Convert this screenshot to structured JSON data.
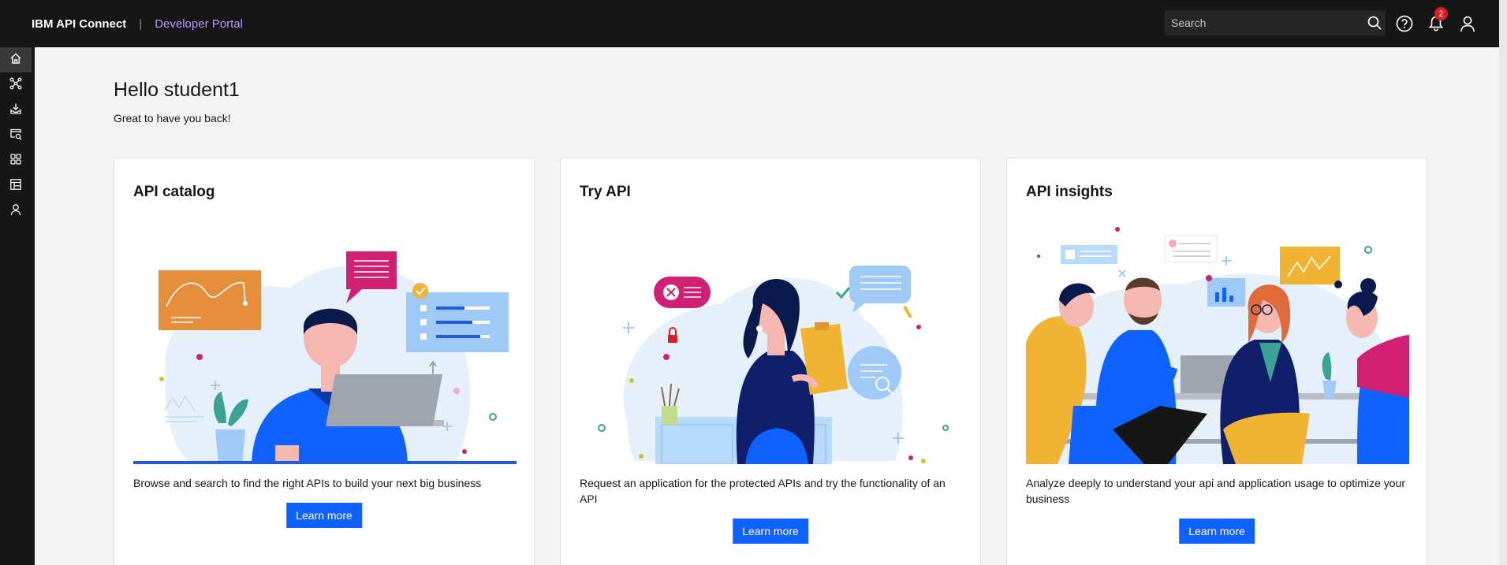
{
  "header": {
    "product_name": "IBM API Connect",
    "separator": "|",
    "portal_name": "Developer Portal",
    "search_placeholder": "Search",
    "notification_count": "2"
  },
  "sidebar": {
    "items": [
      {
        "icon": "home-icon"
      },
      {
        "icon": "api-network-icon"
      },
      {
        "icon": "download-apps-icon"
      },
      {
        "icon": "catalog-search-icon"
      },
      {
        "icon": "apps-grid-icon"
      },
      {
        "icon": "dashboard-table-icon"
      },
      {
        "icon": "user-icon"
      }
    ]
  },
  "main": {
    "greeting": "Hello student1",
    "subgreeting": "Great to have you back!",
    "cards": [
      {
        "title": "API catalog",
        "description": "Browse and search to find the right APIs to build your next big business",
        "button_label": "Learn more"
      },
      {
        "title": "Try API",
        "description": "Request an application for the protected APIs and try the functionality of an API",
        "button_label": "Learn more"
      },
      {
        "title": "API insights",
        "description": "Analyze deeply to understand your api and application usage to optimize your business",
        "button_label": "Learn more"
      }
    ]
  },
  "colors": {
    "header_bg": "#161616",
    "portal_accent": "#be95ff",
    "primary_button": "#0f62fe",
    "badge": "#da1e28",
    "page_bg": "#f4f4f4"
  }
}
